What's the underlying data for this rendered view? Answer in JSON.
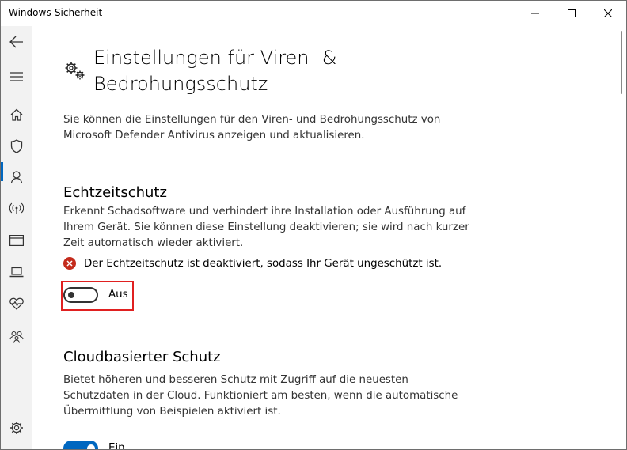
{
  "window": {
    "title": "Windows-Sicherheit"
  },
  "sidebar": {
    "items": [
      {
        "icon": "back-icon"
      },
      {
        "icon": "hamburger-icon"
      },
      {
        "icon": "home-icon"
      },
      {
        "icon": "shield-icon",
        "active": true
      },
      {
        "icon": "account-icon"
      },
      {
        "icon": "network-icon"
      },
      {
        "icon": "app-browser-icon"
      },
      {
        "icon": "device-icon"
      },
      {
        "icon": "heart-icon"
      },
      {
        "icon": "family-icon"
      },
      {
        "icon": "settings-icon"
      }
    ]
  },
  "page": {
    "title": "Einstellungen für Viren- & Bedrohungsschutz",
    "description": "Sie können die Einstellungen für den Viren- und Bedrohungsschutz von Microsoft Defender Antivirus anzeigen und aktualisieren."
  },
  "realtime": {
    "heading": "Echtzeitschutz",
    "description": "Erkennt Schadsoftware und verhindert ihre Installation oder Ausführung auf Ihrem Gerät. Sie können diese Einstellung deaktivieren; sie wird nach kurzer Zeit automatisch wieder aktiviert.",
    "warning": "Der Echtzeitschutz ist deaktiviert, sodass Ihr Gerät ungeschützt ist.",
    "toggle_label": "Aus",
    "enabled": false
  },
  "cloud": {
    "heading": "Cloudbasierter Schutz",
    "description": "Bietet höheren und besseren Schutz mit Zugriff auf die neuesten Schutzdaten in der Cloud. Funktioniert am besten, wenn die automatische Übermittlung von Beispielen aktiviert ist.",
    "toggle_label": "Ein",
    "enabled": true
  },
  "colors": {
    "accent": "#0067c0",
    "error": "#c42b1c",
    "highlight": "#e02020"
  }
}
